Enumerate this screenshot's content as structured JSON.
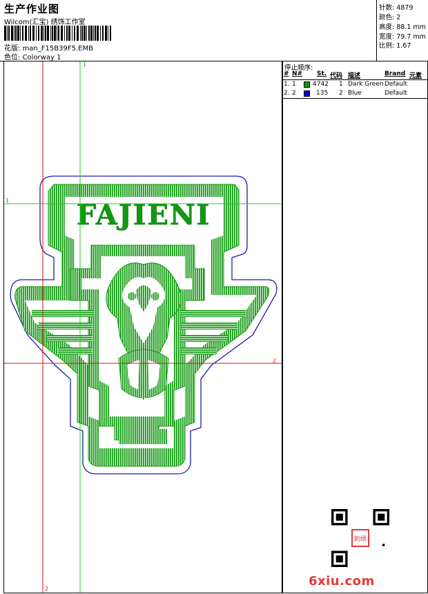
{
  "header": {
    "title": "生产作业图",
    "company": "Wilcom(汇宝) 绣饰工作室",
    "design_label": "花版:",
    "design_value": "man_F15B39F5.EMB",
    "colorway_label": "色位:",
    "colorway_value": "Colorway 1"
  },
  "stats": [
    {
      "label": "针数:",
      "value": "4879"
    },
    {
      "label": "颜色:",
      "value": "2"
    },
    {
      "label": "高度:",
      "value": "88.1 mm"
    },
    {
      "label": "宽度:",
      "value": "79.7 mm"
    },
    {
      "label": "比例:",
      "value": "1.67"
    }
  ],
  "guides": {
    "green_marker": "1",
    "red_marker": "2"
  },
  "design": {
    "text": "FAJIENI",
    "thread_colors": {
      "dark_green": "#119911",
      "blue": "#0000dd",
      "outline": "#1a1aaa"
    }
  },
  "stop_sequence": {
    "title": "停止顺序:",
    "headers": [
      "#",
      "N#",
      "St.",
      "代码",
      "描述",
      "Brand",
      "元素"
    ],
    "rows": [
      {
        "index": "1.",
        "n": "1",
        "swatch": "#119911",
        "stitches": "4742",
        "code": "1",
        "desc": "Dark Green",
        "brand": "Default"
      },
      {
        "index": "2.",
        "n": "2",
        "swatch": "#0000dd",
        "stitches": "135",
        "code": "2",
        "desc": "Blue",
        "brand": "Default"
      }
    ]
  },
  "watermark": {
    "site": "6xiu.com",
    "seal": "刺绣"
  }
}
